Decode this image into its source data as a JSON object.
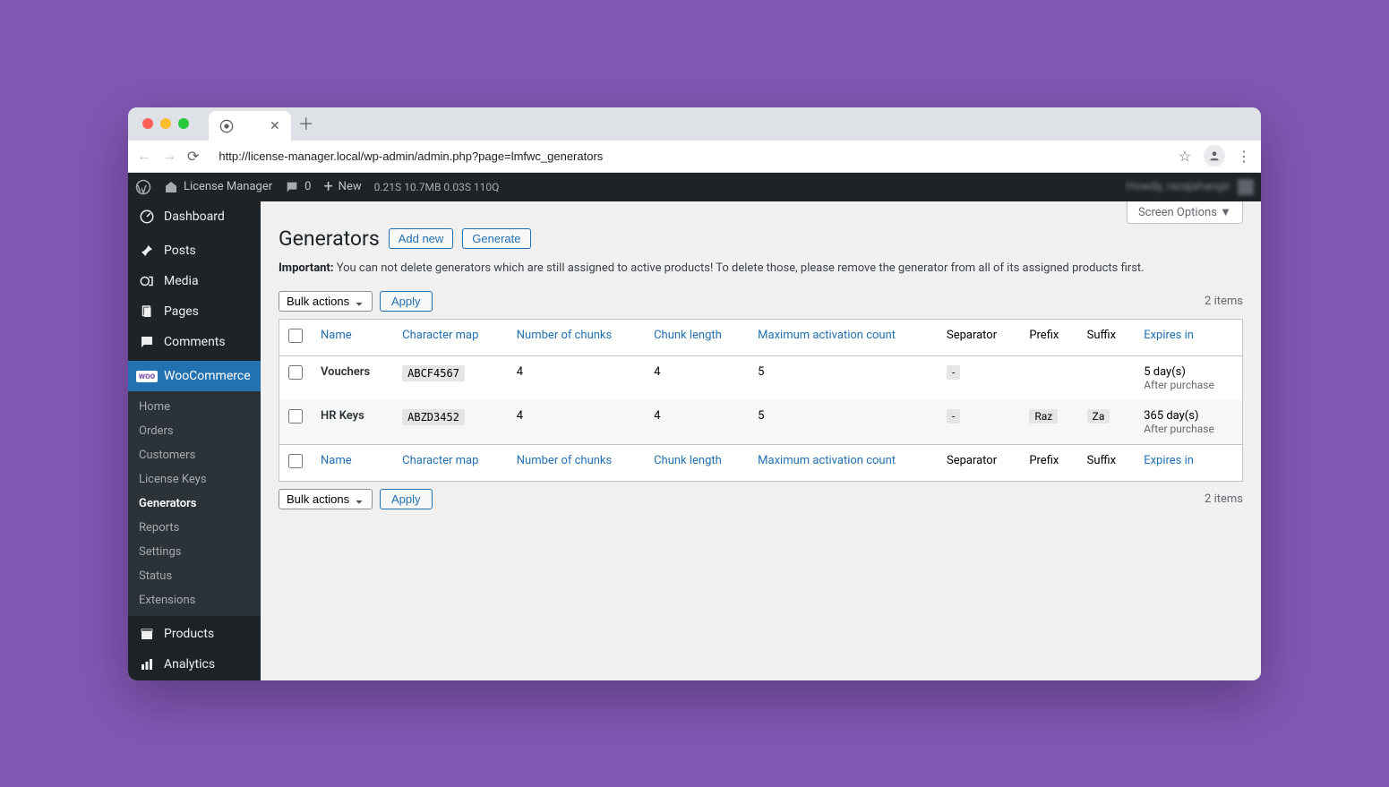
{
  "browser": {
    "url": "http://license-manager.local/wp-admin/admin.php?page=lmfwc_generators"
  },
  "adminBar": {
    "siteName": "License Manager",
    "commentCount": "0",
    "newLabel": "New",
    "stats": "0.21S  10.7MB  0.03S  110Q",
    "howdy": "Howdy, razajahangir"
  },
  "sidebar": {
    "items": [
      {
        "icon": "dashboard-icon",
        "label": "Dashboard"
      },
      {
        "icon": "pin-icon",
        "label": "Posts"
      },
      {
        "icon": "media-icon",
        "label": "Media"
      },
      {
        "icon": "page-icon",
        "label": "Pages"
      },
      {
        "icon": "comment-icon",
        "label": "Comments"
      },
      {
        "icon": "woo-icon",
        "label": "WooCommerce",
        "current": true
      },
      {
        "icon": "product-icon",
        "label": "Products"
      },
      {
        "icon": "analytics-icon",
        "label": "Analytics"
      }
    ],
    "wooSubmenu": [
      "Home",
      "Orders",
      "Customers",
      "License Keys",
      "Generators",
      "Reports",
      "Settings",
      "Status",
      "Extensions"
    ],
    "wooSubmenuCurrent": "Generators"
  },
  "screenOptions": "Screen Options",
  "page": {
    "title": "Generators",
    "addNewLabel": "Add new",
    "generateLabel": "Generate",
    "noticeStrong": "Important:",
    "noticeText": " You can not delete generators which are still assigned to active products! To delete those, please remove the generator from all of its assigned products first.",
    "bulkActionsLabel": "Bulk actions",
    "applyLabel": "Apply",
    "itemsCount": "2 items"
  },
  "table": {
    "columns": {
      "name": "Name",
      "charmap": "Character map",
      "chunks": "Number of chunks",
      "chunklen": "Chunk length",
      "maxact": "Maximum activation count",
      "separator": "Separator",
      "prefix": "Prefix",
      "suffix": "Suffix",
      "expires": "Expires in"
    },
    "rows": [
      {
        "name": "Vouchers",
        "charmap": "ABCF4567",
        "chunks": "4",
        "chunklen": "4",
        "maxact": "5",
        "separator": "-",
        "prefix": "",
        "suffix": "",
        "expires": "5 day(s)",
        "expiresSub": "After purchase"
      },
      {
        "name": "HR Keys",
        "charmap": "ABZD3452",
        "chunks": "4",
        "chunklen": "4",
        "maxact": "5",
        "separator": "-",
        "prefix": "Raz",
        "suffix": "Za",
        "expires": "365 day(s)",
        "expiresSub": "After purchase"
      }
    ]
  }
}
